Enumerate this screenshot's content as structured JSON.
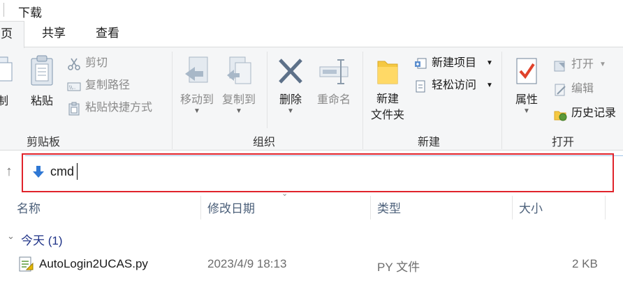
{
  "window": {
    "title": "下载"
  },
  "tabs": [
    {
      "label": "页",
      "active": true
    },
    {
      "label": "共享",
      "active": false
    },
    {
      "label": "查看",
      "active": false
    }
  ],
  "ribbon": {
    "clipboard": {
      "group_label": "剪贴板",
      "copy_label": "制",
      "paste_label": "粘贴",
      "cut_label": "剪切",
      "copy_path_label": "复制路径",
      "paste_shortcut_label": "粘贴快捷方式"
    },
    "organize": {
      "group_label": "组织",
      "move_to_label": "移动到",
      "copy_to_label": "复制到",
      "delete_label": "删除",
      "rename_label": "重命名"
    },
    "new": {
      "group_label": "新建",
      "new_folder_line1": "新建",
      "new_folder_line2": "文件夹",
      "new_item_label": "新建项目",
      "easy_access_label": "轻松访问"
    },
    "open": {
      "group_label": "打开",
      "properties_label": "属性",
      "open_label": "打开",
      "edit_label": "编辑",
      "history_label": "历史记录"
    }
  },
  "address_bar": {
    "value": "cmd",
    "highlight_color": "#e0232b"
  },
  "columns": {
    "name": "名称",
    "modified": "修改日期",
    "type": "类型",
    "size": "大小"
  },
  "group": {
    "label": "今天 (1)"
  },
  "files": [
    {
      "name": "AutoLogin2UCAS.py",
      "modified": "2023/4/9 18:13",
      "type": "PY 文件",
      "size": "2 KB"
    }
  ]
}
